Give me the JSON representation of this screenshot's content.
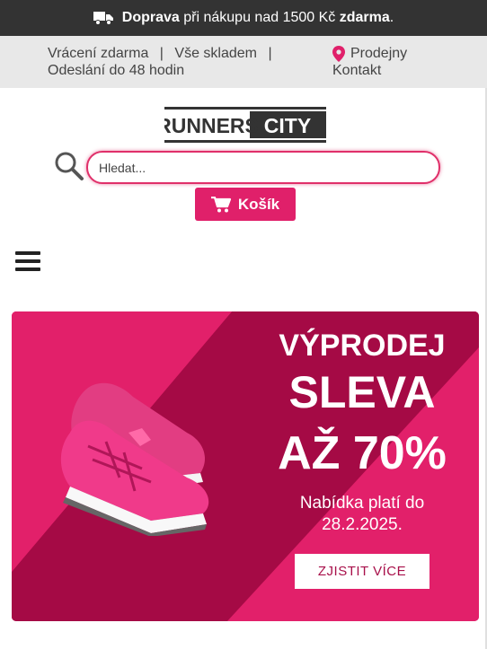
{
  "topbar": {
    "bold1": "Doprava",
    "middle": " při nákupu nad 1500 Kč ",
    "bold2": "zdarma",
    "end": "."
  },
  "infobar": {
    "free_returns": "Vrácení zdarma",
    "in_stock": "Vše skladem",
    "shipping": "Odeslání do 48 hodin",
    "separator": "|",
    "stores": "Prodejny",
    "contact": "Kontakt"
  },
  "logo": {
    "left": "RUNNERS",
    "right": "CITY"
  },
  "search": {
    "placeholder": "Hledat..."
  },
  "cart": {
    "label": "Košík"
  },
  "banner": {
    "line1": "VÝPRODEJ",
    "line2": "SLEVA",
    "line3": "AŽ 70%",
    "offer": "Nabídka platí do",
    "date": "28.2.2025.",
    "cta": "ZJISTIT VÍCE"
  },
  "colors": {
    "accent": "#e0206a",
    "dark": "#333333",
    "banner_dark": "#a50a45"
  }
}
